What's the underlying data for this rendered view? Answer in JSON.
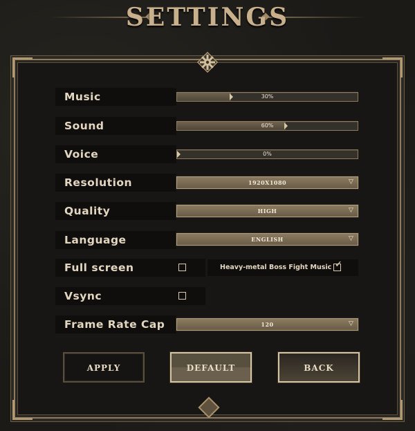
{
  "title": "SETTINGS",
  "rows": {
    "music": {
      "label": "Music",
      "value": 30,
      "value_text": "30%"
    },
    "sound": {
      "label": "Sound",
      "value": 60,
      "value_text": "60%"
    },
    "voice": {
      "label": "Voice",
      "value": 0,
      "value_text": "0%"
    },
    "resolution": {
      "label": "Resolution",
      "value": "1920X1080"
    },
    "quality": {
      "label": "Quality",
      "value": "HIGH"
    },
    "language": {
      "label": "Language",
      "value": "ENGLISH"
    },
    "fullscreen": {
      "label": "Full screen",
      "checked": false
    },
    "heavy_metal": {
      "label": "Heavy-metal Boss Fight Music",
      "checked": true
    },
    "vsync": {
      "label": "Vsync",
      "checked": false
    },
    "frame_rate_cap": {
      "label": "Frame Rate Cap",
      "value": "120"
    }
  },
  "buttons": {
    "apply": "APPLY",
    "default": "DEFAULT",
    "back": "BACK"
  },
  "icons": {
    "dropdown_arrow": "chevron-down-icon",
    "gear": "gear-icon",
    "checkmark": "checkmark-icon"
  },
  "colors": {
    "accent": "#c9b08c",
    "panel": "#171614",
    "label_bg": "#0f0e0d",
    "border": "#8f7c5e"
  }
}
